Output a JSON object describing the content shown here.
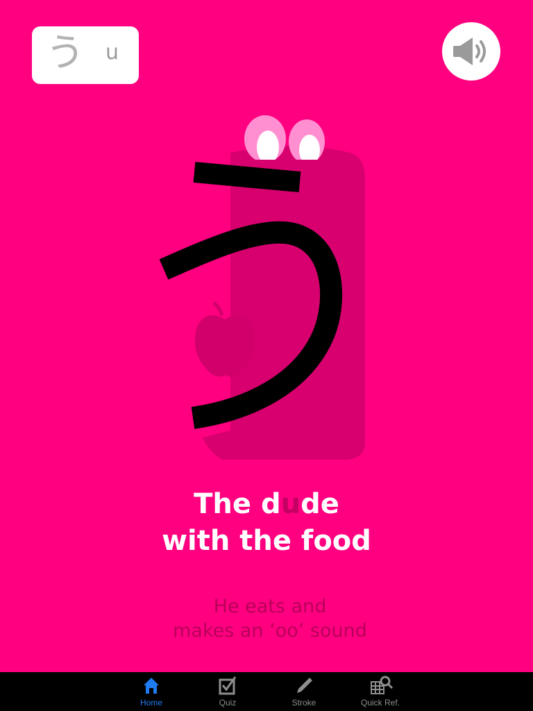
{
  "kana_badge": {
    "kana": "う",
    "romaji": "u"
  },
  "icons": {
    "speaker": "speaker-icon",
    "home": "home-icon",
    "quiz": "checkbox-icon",
    "stroke": "pencil-icon",
    "quick_ref": "grid-search-icon"
  },
  "character": {
    "glyph": "う"
  },
  "headline": {
    "part1": "The d",
    "highlight": "u",
    "part2": "de",
    "line2": "with the food"
  },
  "subtext": {
    "line1": "He eats and",
    "line2": "makes an ‘oo’ sound"
  },
  "tabbar": {
    "tabs": [
      {
        "label": "Home",
        "active": true
      },
      {
        "label": "Quiz",
        "active": false
      },
      {
        "label": "Stroke",
        "active": false
      },
      {
        "label": "Quick Ref.",
        "active": false
      }
    ]
  },
  "colors": {
    "background": "#FF0080",
    "accent": "#1E7CF2",
    "highlight": "#C40063"
  }
}
